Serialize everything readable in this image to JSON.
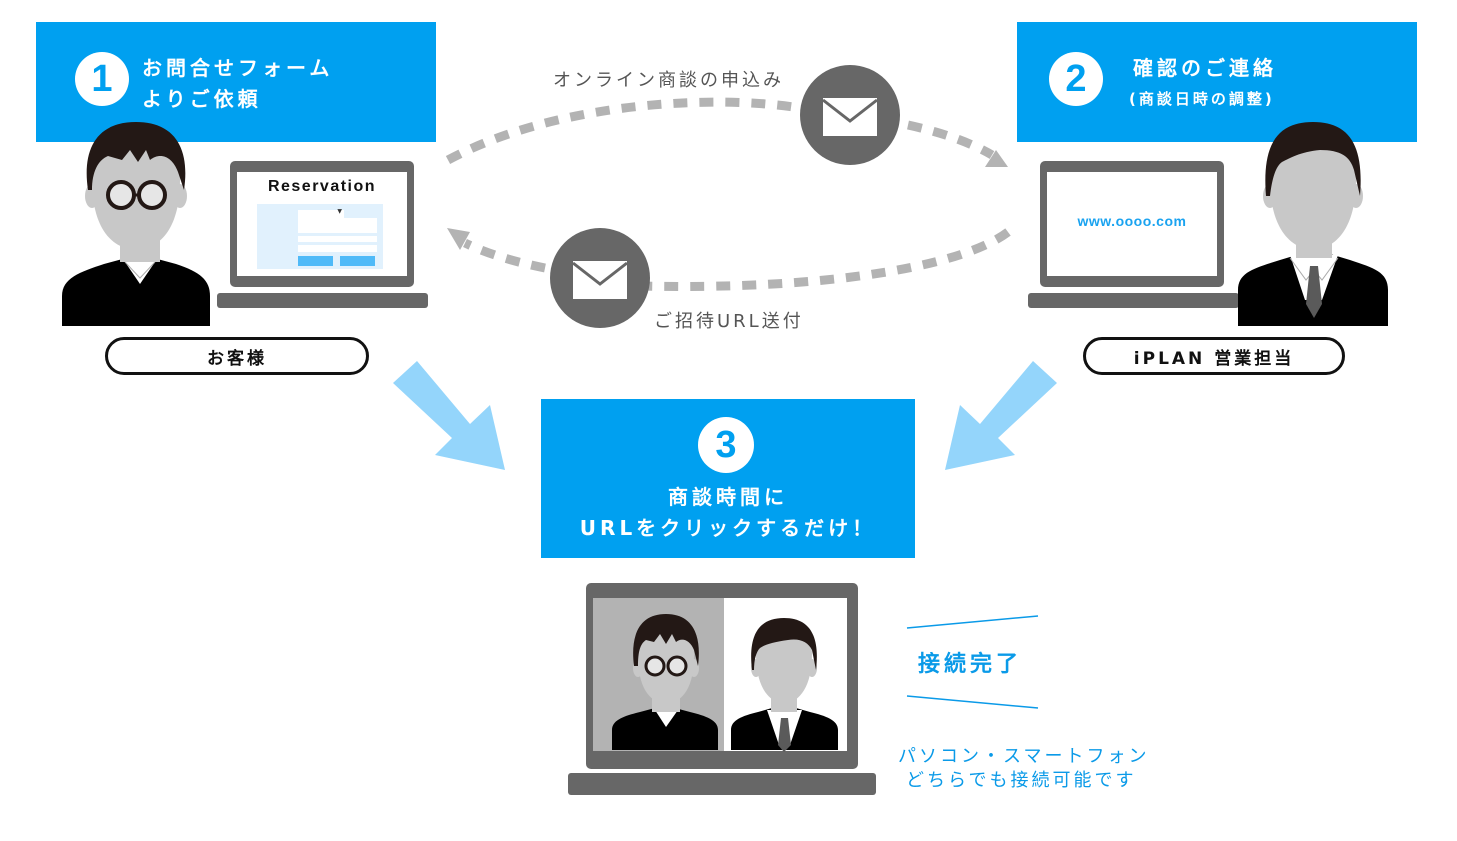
{
  "colors": {
    "accent": "#00a0f0",
    "arrow_light": "#94d5fb",
    "dash_gray": "#b3b3b3",
    "laptop_gray": "#676767",
    "envelope_circle": "#676767",
    "caption_blue": "#0a9ae8"
  },
  "steps": [
    {
      "number": "1",
      "title_line1": "お問合せフォーム",
      "title_line2": "よりご依頼"
    },
    {
      "number": "2",
      "title_line1": "確認のご連絡",
      "title_line2": "(商談日時の調整)"
    },
    {
      "number": "3",
      "title_line1": "商談時間に",
      "title_line2": "URLをクリックするだけ！"
    }
  ],
  "roles": {
    "customer": "お客様",
    "sales": "iPLAN 営業担当"
  },
  "customer_laptop": {
    "screen_title": "Reservation",
    "dropdown_icon": "caret-down-icon"
  },
  "sales_laptop": {
    "screen_url": "www.oooo.com"
  },
  "flows": {
    "request": {
      "label": "オンライン商談の申込み",
      "icon": "envelope-icon"
    },
    "invite": {
      "label": "ご招待URL送付",
      "icon": "envelope-icon"
    }
  },
  "connection": {
    "status": "接続完了",
    "note_line1": "パソコン・スマートフォン",
    "note_line2": "どちらでも接続可能です"
  }
}
